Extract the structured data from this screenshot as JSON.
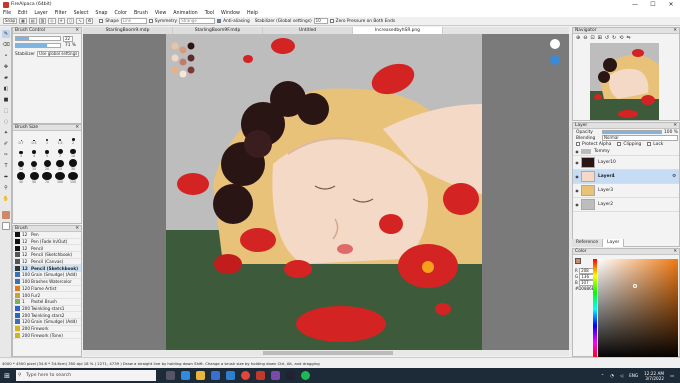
{
  "window": {
    "title": "FireAlpaca (64bit)",
    "controls": [
      "—",
      "☐",
      "✕"
    ]
  },
  "menu": [
    "File",
    "Edit",
    "Layer",
    "Filter",
    "Select",
    "Snap",
    "Color",
    "Brush",
    "View",
    "Animation",
    "Tool",
    "Window",
    "Help"
  ],
  "toolbar": {
    "snap_label": "Snap",
    "shape_label": "Shape",
    "shape_value": "Line",
    "symmetry_label": "Symmetry",
    "symmetry_value": "Strange",
    "antialias_label": "Anti-aliasing",
    "stabilizer_label": "Stabilizer (Global settings)",
    "stabilizer_value": "10",
    "zero_pressure_label": "Zero Pressure on Both Ends"
  },
  "brush_control": {
    "title": "Brush Control",
    "size_value": "22",
    "opacity_value": "71 %",
    "size_fill": 0.3,
    "opacity_fill": 0.71,
    "stabilizer_label": "Stabilizer",
    "stabilizer_value": "Use global settings"
  },
  "brush_size": {
    "title": "Brush Size",
    "labels": [
      "0.7",
      "0.5",
      "1",
      "1.5",
      "2",
      "3",
      "4",
      "5",
      "7",
      "10",
      "12",
      "15",
      "20",
      "25",
      "30",
      "40",
      "50",
      "70",
      "100",
      "150"
    ]
  },
  "brush_list": {
    "title": "Brush",
    "items": [
      {
        "size": "12",
        "name": "Pen",
        "color": "#111111"
      },
      {
        "size": "12",
        "name": "Pen (Fade In/Out)",
        "color": "#111111"
      },
      {
        "size": "12",
        "name": "Pencil",
        "color": "#111111"
      },
      {
        "size": "12",
        "name": "Pencil (Sketchbook)",
        "color": "#555555"
      },
      {
        "size": "12",
        "name": "Pencil (Canvas)",
        "color": "#555555"
      },
      {
        "size": "12",
        "name": "Pencil (Sketchbook)",
        "color": "#333333"
      },
      {
        "size": "100",
        "name": "Grain (Smudge) (Add)",
        "color": "#3b6fb6"
      },
      {
        "size": "100",
        "name": "Brashes Watercolor",
        "color": "#3b6fb6"
      },
      {
        "size": "120",
        "name": "Flame Artist",
        "color": "#e07b1a"
      },
      {
        "size": "100",
        "name": "Fur2",
        "color": "#c9a03a"
      },
      {
        "size": "1",
        "name": "Pastel Brush",
        "color": "#7ab45a"
      },
      {
        "size": "200",
        "name": "Twinkling stars1",
        "color": "#2e62c6"
      },
      {
        "size": "200",
        "name": "Twinkling stars2",
        "color": "#2e62c6"
      },
      {
        "size": "120",
        "name": "Grain (Smudge) (Add)",
        "color": "#3b6fb6"
      },
      {
        "size": "200",
        "name": "Firework",
        "color": "#d6b21a"
      },
      {
        "size": "200",
        "name": "Firework (Tone)",
        "color": "#d6b21a"
      }
    ],
    "selected_index": 5
  },
  "tabs": [
    "StarlingBoom9.mdp",
    "StarlingBoom9F.mdp",
    "Untitled",
    "IncreasedbyhSR.png"
  ],
  "active_tab": 3,
  "navigator": {
    "title": "Navigator"
  },
  "layers": {
    "title": "Layer",
    "opacity_label": "Opacity",
    "opacity_value": "100 %",
    "blending_label": "Blending",
    "blending_value": "Normal",
    "protect_alpha": "Protect Alpha",
    "clipping": "Clipping",
    "lock": "Lock",
    "items": [
      "Tommy",
      "Layer10",
      "Layer4",
      "Layer3",
      "Layer2"
    ],
    "selected_index": 2,
    "tabs": [
      "Reference",
      "Layer"
    ]
  },
  "color": {
    "title": "Color",
    "r": "208",
    "g": "136",
    "b": "107",
    "hex": "#D0886B",
    "foreground": "#d0886b",
    "background": "#ffffff"
  },
  "status": {
    "text": "4000 * 4500 pixel   (34.6 * 34.6cm)   350 dpi   18 %   ( 2271, 4739 )   Draw a straight line by holding down Shift. Change a brush size by holding down Ctrl, Alt, and dragging"
  },
  "taskbar": {
    "search_placeholder": "Type here to search",
    "lang": "ENG",
    "time": "12:22 AM",
    "date": "3/7/2022"
  },
  "colors": {
    "canvas_bg": "#bebdbd",
    "ground": "#3d5a3b",
    "skin": "#f3d9c6",
    "hair": "#e9c27a",
    "roses": "#2a1515",
    "petal": "#d42323",
    "accent": "#3b8ad9"
  }
}
